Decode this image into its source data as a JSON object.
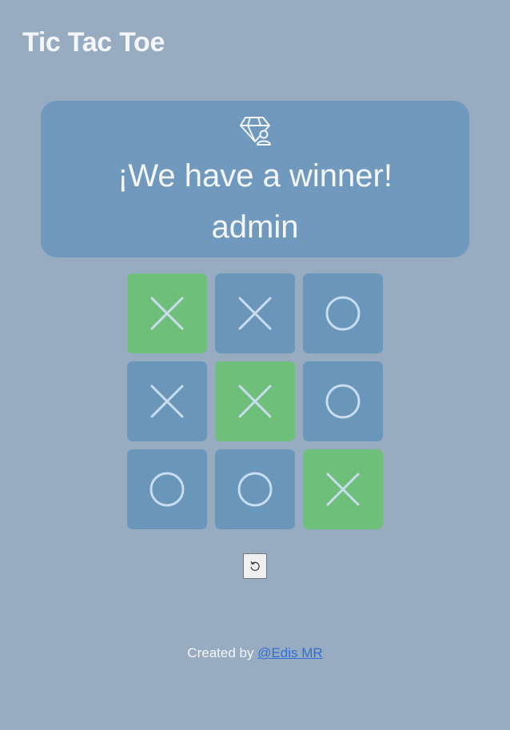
{
  "app": {
    "title": "Tic Tac Toe"
  },
  "winner": {
    "icon": "diamond-user-icon",
    "heading": "¡We have a winner!",
    "name": "admin"
  },
  "board": {
    "cells": [
      "X",
      "X",
      "O",
      "X",
      "X",
      "O",
      "O",
      "O",
      "X"
    ],
    "winning_cells": [
      0,
      4,
      8
    ]
  },
  "controls": {
    "reset_icon": "undo-icon"
  },
  "footer": {
    "prefix": "Created by ",
    "link_text": "@Edis MR"
  },
  "colors": {
    "background": "#97abc1",
    "card": "#7199bd",
    "cell": "#6996b9",
    "win_cell": "#6dbf7a",
    "mark": "#c9ddef",
    "link": "#2f6fd6"
  }
}
